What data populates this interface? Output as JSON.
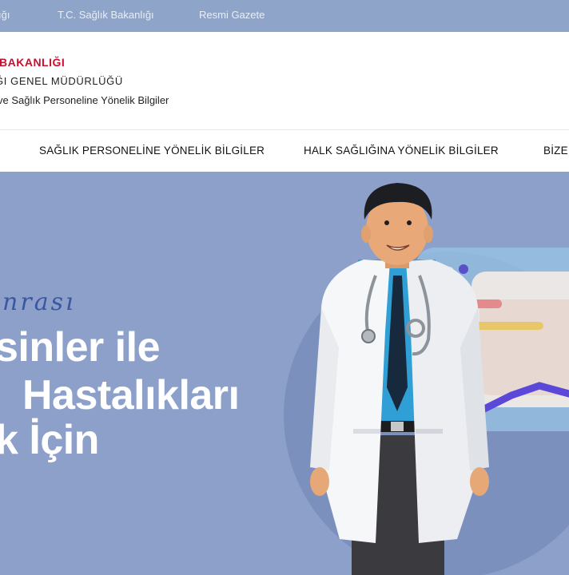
{
  "topbar": {
    "links": [
      "ığı",
      "T.C. Sağlık Bakanlığı",
      "Resmi Gazete"
    ]
  },
  "header": {
    "ministry": "K BAKANLIĞI",
    "directorate": "ĞI GENEL MÜDÜRLÜĞÜ",
    "subtitle": "ve Sağlık Personeline Yönelik Bilgiler"
  },
  "nav": {
    "items": [
      "SAĞLIK PERSONELİNE YÖNELİK BİLGİLER",
      "HALK SAĞLIĞINA YÖNELİK BİLGİLER",
      "BİZE"
    ]
  },
  "hero": {
    "script_text": "onrası",
    "headline_lines": [
      "sinler ile",
      "Hastalıkları",
      "k İçin"
    ]
  },
  "colors": {
    "topbar": "#8fa4c9",
    "hero_bg": "#8da0c9",
    "brand_red": "#c8102e",
    "script_blue": "#3a57a3"
  }
}
